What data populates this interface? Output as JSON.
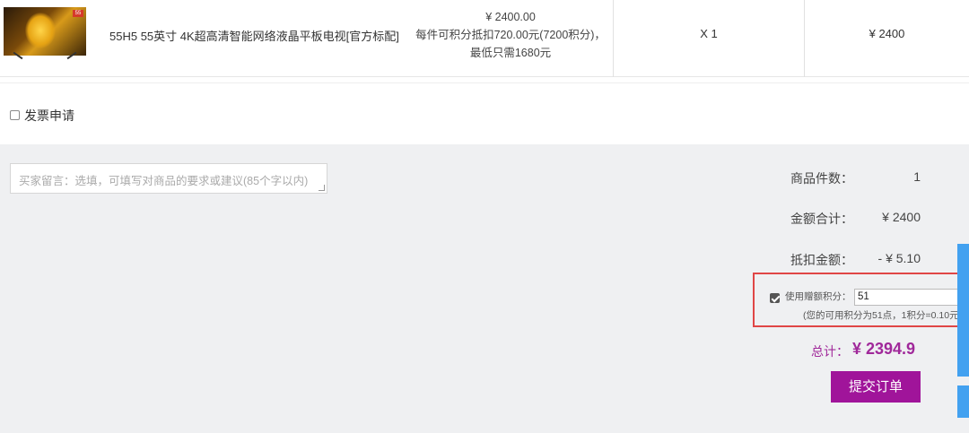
{
  "product": {
    "name": "55H5 55英寸 4K超高清智能网络液晶平板电视[官方标配]",
    "price": "¥ 2400.00",
    "points_note_1": "每件可积分抵扣720.00元(7200积分)，",
    "points_note_2": "最低只需1680元",
    "quantity": "X 1",
    "subtotal": "¥ 2400",
    "thumb_badge": "55"
  },
  "invoice": {
    "label": "发票申请",
    "checked": false
  },
  "remark": {
    "placeholder": "买家留言：选填，可填写对商品的要求或建议(85个字以内)"
  },
  "summary": {
    "count_label": "商品件数：",
    "count_value": "1",
    "amount_label": "金额合计：",
    "amount_value": "¥ 2400",
    "discount_label": "抵扣金额：",
    "discount_value": "-  ¥ 5.10",
    "points": {
      "checked": true,
      "label": "使用赠额积分：",
      "input_value": "51",
      "hint": "(您的可用积分为51点，1积分=0.10元"
    },
    "total_label": "总计：",
    "total_value": "¥ 2394.9",
    "submit_label": "提交订单"
  },
  "colors": {
    "accent": "#a0149a",
    "highlight_border": "#e04646",
    "side_tab": "#42a1f0"
  }
}
